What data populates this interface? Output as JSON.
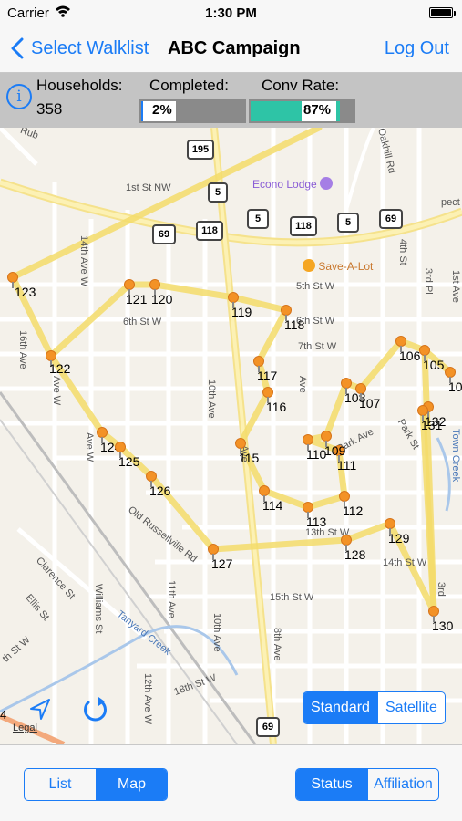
{
  "status_bar": {
    "carrier": "Carrier",
    "time": "1:30 PM"
  },
  "nav": {
    "back_label": "Select Walklist",
    "title": "ABC Campaign",
    "logout_label": "Log Out"
  },
  "stats": {
    "households_label": "Households:",
    "households_value": "358",
    "completed_label": "Completed:",
    "completed_value": "2%",
    "completed_fraction": 0.02,
    "conv_rate_label": "Conv Rate:",
    "conv_rate_value": "87%",
    "conv_rate_fraction": 0.87,
    "conv_color": "#2ec4a6"
  },
  "map": {
    "streets": [
      "1st St NW",
      "5th St W",
      "6th St W",
      "7th St W",
      "13th St W",
      "14th St W",
      "15th St W",
      "18th St W",
      "Old Russellville Rd",
      "Tanyard Creek",
      "Park Ave",
      "Park St",
      "Oakhill Rd",
      "Clarence St",
      "Ellis St",
      "Williams St",
      "14th Ave W",
      "16th Ave",
      "10th Ave",
      "12th Ave W",
      "11th Ave",
      "8th Ave",
      "4th St",
      "3rd Pl",
      "3rd",
      "1st Ave",
      "Town Creek",
      "Rub",
      "pect Rd",
      "Ave",
      "Ave W",
      "St W",
      "th St W"
    ],
    "pois": {
      "econo_lodge": "Econo Lodge",
      "save_a_lot": "Save-A-Lot"
    },
    "shields": [
      "195",
      "5",
      "69",
      "118",
      "5",
      "118",
      "5",
      "69",
      "69"
    ],
    "stops": [
      "123",
      "122",
      "121",
      "120",
      "119",
      "118",
      "117",
      "116",
      "115",
      "114",
      "113",
      "112",
      "111",
      "110",
      "109",
      "108",
      "107",
      "106",
      "105",
      "10",
      "132",
      "131",
      "124",
      "125",
      "126",
      "127",
      "128",
      "129",
      "130"
    ],
    "legal": "Legal",
    "left_edge_num": "4",
    "type_options": [
      "Standard",
      "Satellite"
    ],
    "type_selected": "Standard"
  },
  "colors": {
    "accent": "#1b7cf6",
    "route": "#f3dc6a",
    "pin": "#f39226"
  },
  "icons": [
    "info-icon",
    "chevron-left-icon",
    "location-arrow-icon",
    "refresh-icon",
    "wifi-icon",
    "battery-icon",
    "cart-icon",
    "lodging-icon"
  ],
  "toolbar": {
    "view_options": [
      "List",
      "Map"
    ],
    "view_selected": "Map",
    "color_options": [
      "Status",
      "Affiliation"
    ],
    "color_selected": "Status"
  }
}
